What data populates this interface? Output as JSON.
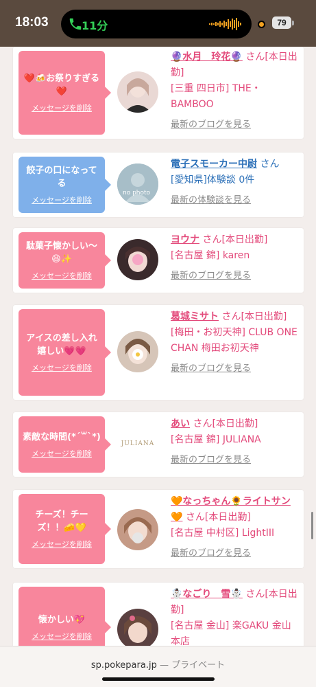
{
  "status": {
    "time": "18:03",
    "call_duration": "11分",
    "battery": "79"
  },
  "cards": [
    {
      "message": "❤️🍻お祭りすぎる❤️",
      "delete_label": "メッセージを削除",
      "name": "🔮水月　玲花🔮",
      "san": "さん",
      "status": "[本日出勤]",
      "location": "[三重 四日市] THE・BAMBOO",
      "link": "最新のブログを見る",
      "bubble_color": "pink"
    },
    {
      "message": "餃子の口になってる",
      "delete_label": "メッセージを削除",
      "name": "電子スモーカー中尉",
      "san": "さん",
      "status": "",
      "location": "[愛知県]体験談 0件",
      "link": "最新の体験談を見る",
      "avatar_text": "no photo",
      "bubble_color": "blue"
    },
    {
      "message": "駄菓子懐かしい〜😆✨",
      "delete_label": "メッセージを削除",
      "name": "ヨウナ",
      "san": "さん",
      "status": "[本日出勤]",
      "location": "[名古屋 錦] karen",
      "link": "最新のブログを見る",
      "bubble_color": "pink"
    },
    {
      "message": "アイスの差し入れ嬉しい💗💗",
      "delete_label": "メッセージを削除",
      "name": "葛城ミサト",
      "san": "さん",
      "status": "[本日出勤]",
      "location": "[梅田・お初天神] CLUB ONE CHAN 梅田お初天神",
      "link": "最新のブログを見る",
      "bubble_color": "pink"
    },
    {
      "message": "素敵な時間(*´꒳`*)",
      "delete_label": "メッセージを削除",
      "name": "あい",
      "san": "さん",
      "status": "[本日出勤]",
      "location": "[名古屋 錦] JULIANA",
      "link": "最新のブログを見る",
      "logo_text": "JULIANA",
      "bubble_color": "pink"
    },
    {
      "message": "チーズ！チーズ！！🧀💛",
      "delete_label": "メッセージを削除",
      "name": "🧡なっちゃん🌻ライトサン🧡",
      "san": "さん",
      "status": "[本日出勤]",
      "location": "[名古屋 中村区] LightIII",
      "link": "最新のブログを見る",
      "bubble_color": "pink"
    },
    {
      "message": "懐かしい💖",
      "delete_label": "メッセージを削除",
      "name": "☃️なごり　雪☃️",
      "san": "さん",
      "status": "[本日出勤]",
      "location": "[名古屋 金山] 楽GAKU 金山本店",
      "link": "",
      "bubble_color": "pink"
    }
  ],
  "urlbar": {
    "domain": "sp.pokepara.jp",
    "separator": " — ",
    "mode": "プライベート"
  },
  "colors": {
    "pink_bubble": "#f8869c",
    "blue_bubble": "#7fb0ea",
    "name_pink": "#e34a7b",
    "name_blue": "#2c70b8"
  }
}
